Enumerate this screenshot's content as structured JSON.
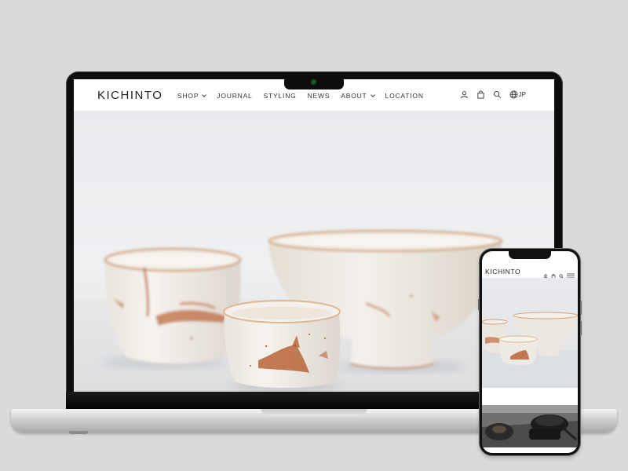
{
  "site": {
    "logo": "KICHINTO",
    "nav": [
      {
        "label": "SHOP",
        "dropdown": true
      },
      {
        "label": "JOURNAL",
        "dropdown": false
      },
      {
        "label": "STYLING",
        "dropdown": false
      },
      {
        "label": "NEWS",
        "dropdown": false
      },
      {
        "label": "ABOUT",
        "dropdown": true
      },
      {
        "label": "LOCATION",
        "dropdown": false
      }
    ],
    "icons": [
      "account-icon",
      "bag-icon",
      "search-icon",
      "globe-icon"
    ],
    "language": "JP"
  },
  "phone": {
    "logo": "KICHINTO",
    "icons": [
      "account-icon",
      "bag-icon",
      "search-icon",
      "menu-icon"
    ]
  },
  "colors": {
    "background": "#dadada",
    "glaze": "#f1ede6",
    "rust": "#b9643a"
  }
}
